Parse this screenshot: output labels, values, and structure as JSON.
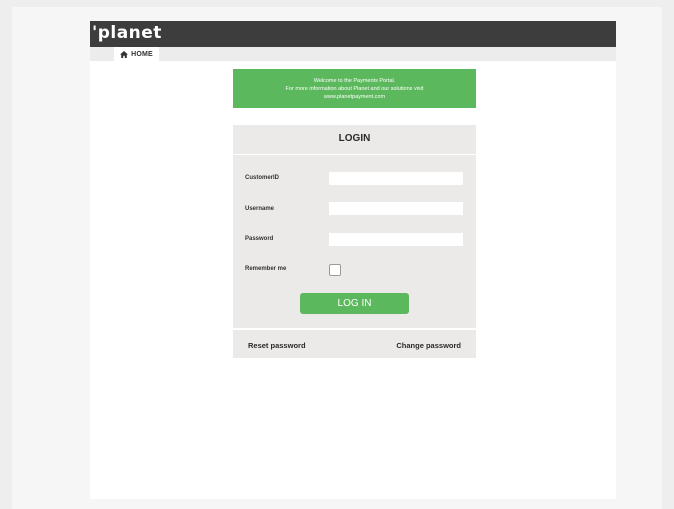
{
  "header": {
    "logo_text": "'planet"
  },
  "nav": {
    "home_label": "HOME"
  },
  "banner": {
    "line1": "Welcome to the Payments Portal.",
    "line2": "For more information about Planet and our solutions visit",
    "line3": "www.planetpayment.com"
  },
  "login": {
    "title": "LOGIN",
    "fields": {
      "customer_id": {
        "label": "CustomerID",
        "value": "",
        "placeholder": ""
      },
      "username": {
        "label": "Username",
        "value": "",
        "placeholder": ""
      },
      "password": {
        "label": "Password",
        "value": "",
        "placeholder": ""
      }
    },
    "remember_label": "Remember me",
    "remember_checked": false,
    "submit_label": "LOG IN",
    "reset_password_label": "Reset password",
    "change_password_label": "Change password"
  },
  "colors": {
    "header_bg": "#3d3d3d",
    "accent_green": "#5cb85c",
    "card_bg": "#ece9e9"
  },
  "icons": {
    "home": "home-icon"
  }
}
